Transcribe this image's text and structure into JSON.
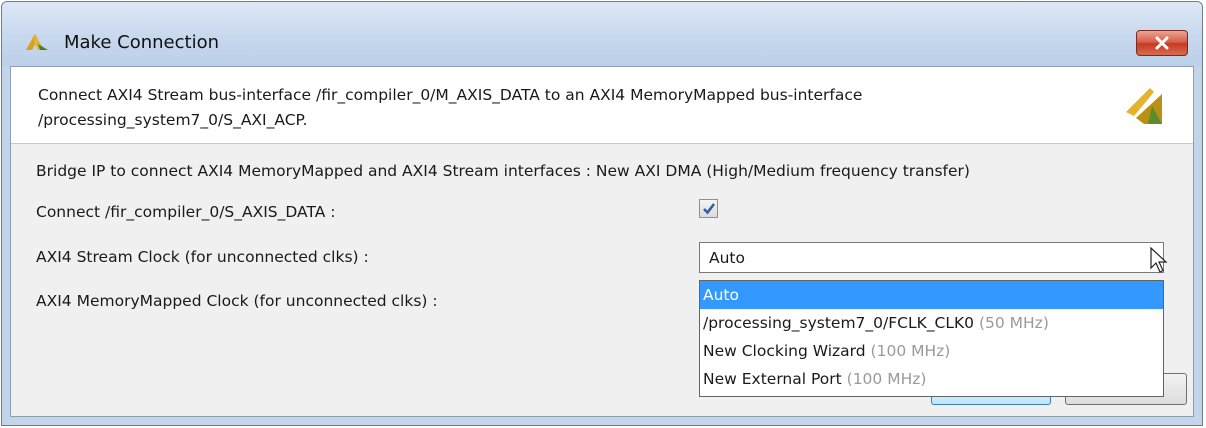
{
  "window": {
    "title": "Make Connection",
    "icon": "vivado-logo-icon",
    "close_icon": "close-icon"
  },
  "header": {
    "line1": "Connect AXI4 Stream bus-interface /fir_compiler_0/M_AXIS_DATA to an AXI4 MemoryMapped bus-interface",
    "line2": "/processing_system7_0/S_AXI_ACP.",
    "logo": "xilinx-logo-icon"
  },
  "form": {
    "bridge_label": "Bridge IP to connect AXI4 MemoryMapped and AXI4 Stream interfaces : New AXI DMA (High/Medium frequency transfer)",
    "connect_label": "Connect /fir_compiler_0/S_AXIS_DATA :",
    "connect_checked": true,
    "stream_clock_label": "AXI4 Stream Clock (for unconnected clks) :",
    "stream_clock_value": "Auto",
    "mm_clock_label": "AXI4 MemoryMapped Clock (for unconnected clks) :"
  },
  "dropdown": {
    "options": [
      {
        "label": "Auto",
        "freq": "",
        "selected": true
      },
      {
        "label": "/processing_system7_0/FCLK_CLK0",
        "freq": "(50 MHz)",
        "selected": false
      },
      {
        "label": "New Clocking Wizard",
        "freq": "(100 MHz)",
        "selected": false
      },
      {
        "label": "New External Port",
        "freq": "(100 MHz)",
        "selected": false
      }
    ]
  },
  "colors": {
    "title_bar": "#c7d8ee",
    "close_button": "#c43a22",
    "selection": "#3399ff",
    "frequency_text": "#9a9a9a"
  }
}
